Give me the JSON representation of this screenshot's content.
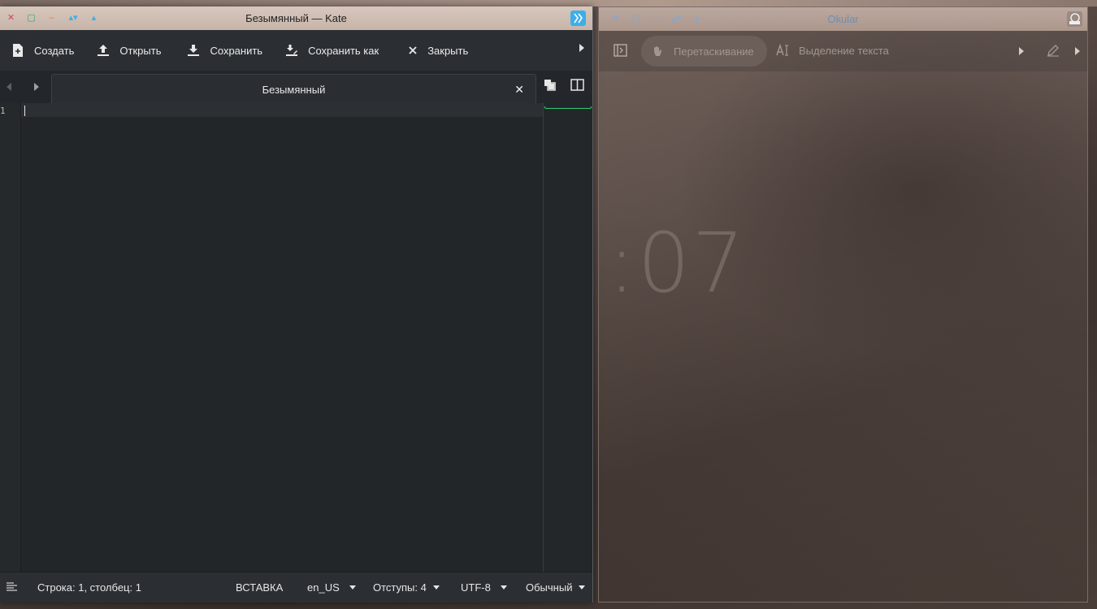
{
  "kate": {
    "title": "Безымянный — Kate",
    "toolbar": {
      "new_label": "Создать",
      "open_label": "Открыть",
      "save_label": "Сохранить",
      "save_as_label": "Сохранить как",
      "close_label": "Закрыть"
    },
    "tab": {
      "label": "Безымянный"
    },
    "editor": {
      "line_number": "1"
    },
    "status": {
      "position": "Строка: 1, столбец: 1",
      "mode": "ВСТАВКА",
      "language": "en_US",
      "indent": "Отступы: 4",
      "encoding": "UTF-8",
      "highlight": "Обычный"
    }
  },
  "okular": {
    "title": "Okular",
    "toolbar": {
      "browse_label": "Перетаскивание",
      "text_select_label": "Выделение текста"
    },
    "clock_text": ":07"
  },
  "colors": {
    "editor_bg": "#232629",
    "accent_green": "#2ecc71",
    "close_red": "#da4453",
    "max_green": "#27ae60",
    "min_orange": "#f47750",
    "kde_blue": "#3daee9"
  }
}
